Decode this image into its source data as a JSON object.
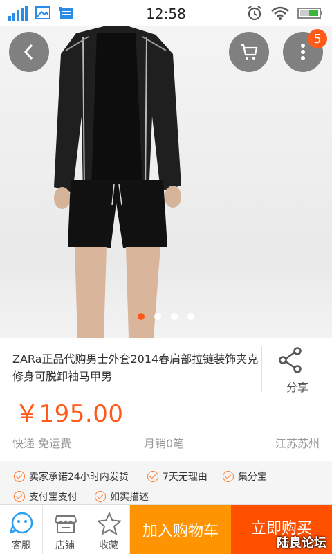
{
  "status_bar": {
    "time": "12:58"
  },
  "top_actions": {
    "badge_count": "5"
  },
  "carousel": {
    "count": 4,
    "active_index": 0
  },
  "product": {
    "title": "ZARa正品代购男士外套2014春肩部拉链装饰夹克修身可脱卸袖马甲男",
    "share_label": "分享",
    "price": "￥195.00",
    "shipping": "快递 免运费",
    "monthly_sales": "月销0笔",
    "location": "江苏苏州"
  },
  "guarantees": [
    "卖家承诺24小时内发货",
    "7天无理由",
    "集分宝",
    "支付宝支付",
    "如实描述"
  ],
  "bottom_bar": {
    "service_label": "客服",
    "shop_label": "店铺",
    "favorite_label": "收藏",
    "add_to_cart_label": "加入购物车",
    "buy_now_label": "立即购买",
    "watermark": "陆良论坛"
  },
  "colors": {
    "accent": "#ff5a1a",
    "cart_button": "#ff9402",
    "buy_button": "#ff5000",
    "status_icons": "#2a8ce6"
  }
}
